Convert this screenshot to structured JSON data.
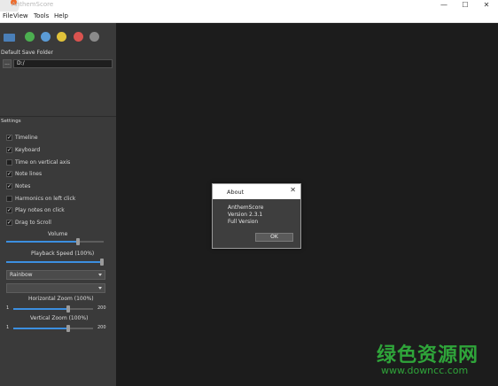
{
  "window": {
    "title": "AnthemScore",
    "minimize": "—",
    "maximize": "☐",
    "close": "✕"
  },
  "menu": {
    "items": [
      "File",
      "View",
      "Tools",
      "Help"
    ]
  },
  "colors": {
    "accent": "#3c8fe0",
    "play": "#4caf50",
    "stop": "#5b9bd5",
    "pause": "#e0c23a",
    "record": "#d9534f",
    "settings": "#8a8a8a",
    "watermark": "#2fa53a"
  },
  "toolbar": {
    "icons": [
      "open-folder-icon",
      "play-icon",
      "stop-icon",
      "pause-icon",
      "record-icon",
      "settings-icon"
    ]
  },
  "save": {
    "label": "Default Save Folder",
    "browse": "...",
    "path": "D:/"
  },
  "settings": {
    "heading": "Settings",
    "options": [
      {
        "label": "Timeline",
        "checked": true
      },
      {
        "label": "Keyboard",
        "checked": true
      },
      {
        "label": "Time on vertical axis",
        "checked": false
      },
      {
        "label": "Note lines",
        "checked": true
      },
      {
        "label": "Notes",
        "checked": true
      },
      {
        "label": "Harmonics on left click",
        "checked": false
      },
      {
        "label": "Play notes on click",
        "checked": true
      },
      {
        "label": "Drag to Scroll",
        "checked": true
      }
    ],
    "volume_label": "Volume",
    "volume_level": 0.75,
    "playback_label": "Playback Speed (100%)",
    "playback_level": 1.0,
    "color_scheme": "Rainbow",
    "second_select": "",
    "hzoom_label": "Horizontal Zoom (100%)",
    "hzoom_min": "1",
    "hzoom_max": "200",
    "vzoom_label": "Vertical Zoom (100%)",
    "vzoom_min": "1",
    "vzoom_max": "200"
  },
  "about": {
    "title": "About",
    "close": "✕",
    "app": "AnthemScore",
    "version": "Version 2.3.1",
    "edition": "Full Version",
    "ok": "OK"
  },
  "watermark": {
    "text": "绿色资源网",
    "url": "www.downcc.com"
  }
}
